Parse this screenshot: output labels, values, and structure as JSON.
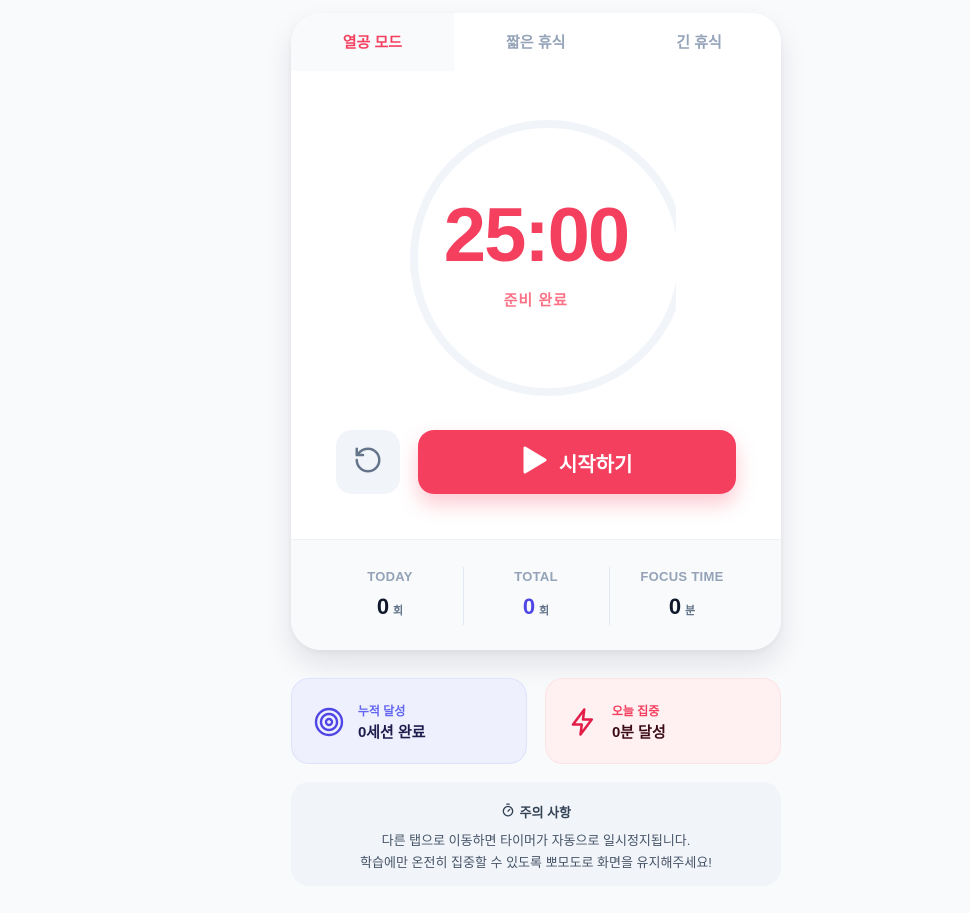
{
  "tabs": [
    {
      "label": "열공 모드",
      "active": true
    },
    {
      "label": "짧은 휴식",
      "active": false
    },
    {
      "label": "긴 휴식",
      "active": false
    }
  ],
  "timer": {
    "time": "25:00",
    "status": "준비 완료",
    "progress": 0
  },
  "controls": {
    "reset_icon": "rotate-ccw-icon",
    "start_label": "시작하기",
    "start_icon": "play-icon"
  },
  "stats": [
    {
      "title": "TODAY",
      "value": "0",
      "unit": "회"
    },
    {
      "title": "TOTAL",
      "value": "0",
      "unit": "회"
    },
    {
      "title": "FOCUS TIME",
      "value": "0",
      "unit": "분"
    }
  ],
  "summary": {
    "cumulative": {
      "label": "누적 달성",
      "value": "0세션 완료",
      "icon": "target-icon"
    },
    "today_focus": {
      "label": "오늘 집중",
      "value": "0분 달성",
      "icon": "zap-icon"
    }
  },
  "notice": {
    "title": "주의 사항",
    "icon": "timer-icon",
    "line1": "다른 탭으로 이동하면 타이머가 자동으로 일시정지됩니다.",
    "line2": "학습에만 온전히 집중할 수 있도록 뽀모도로 화면을 유지해주세요!"
  },
  "colors": {
    "accent": "#f43f5e",
    "indigo": "#4f46e5",
    "background": "#f8fafc"
  }
}
